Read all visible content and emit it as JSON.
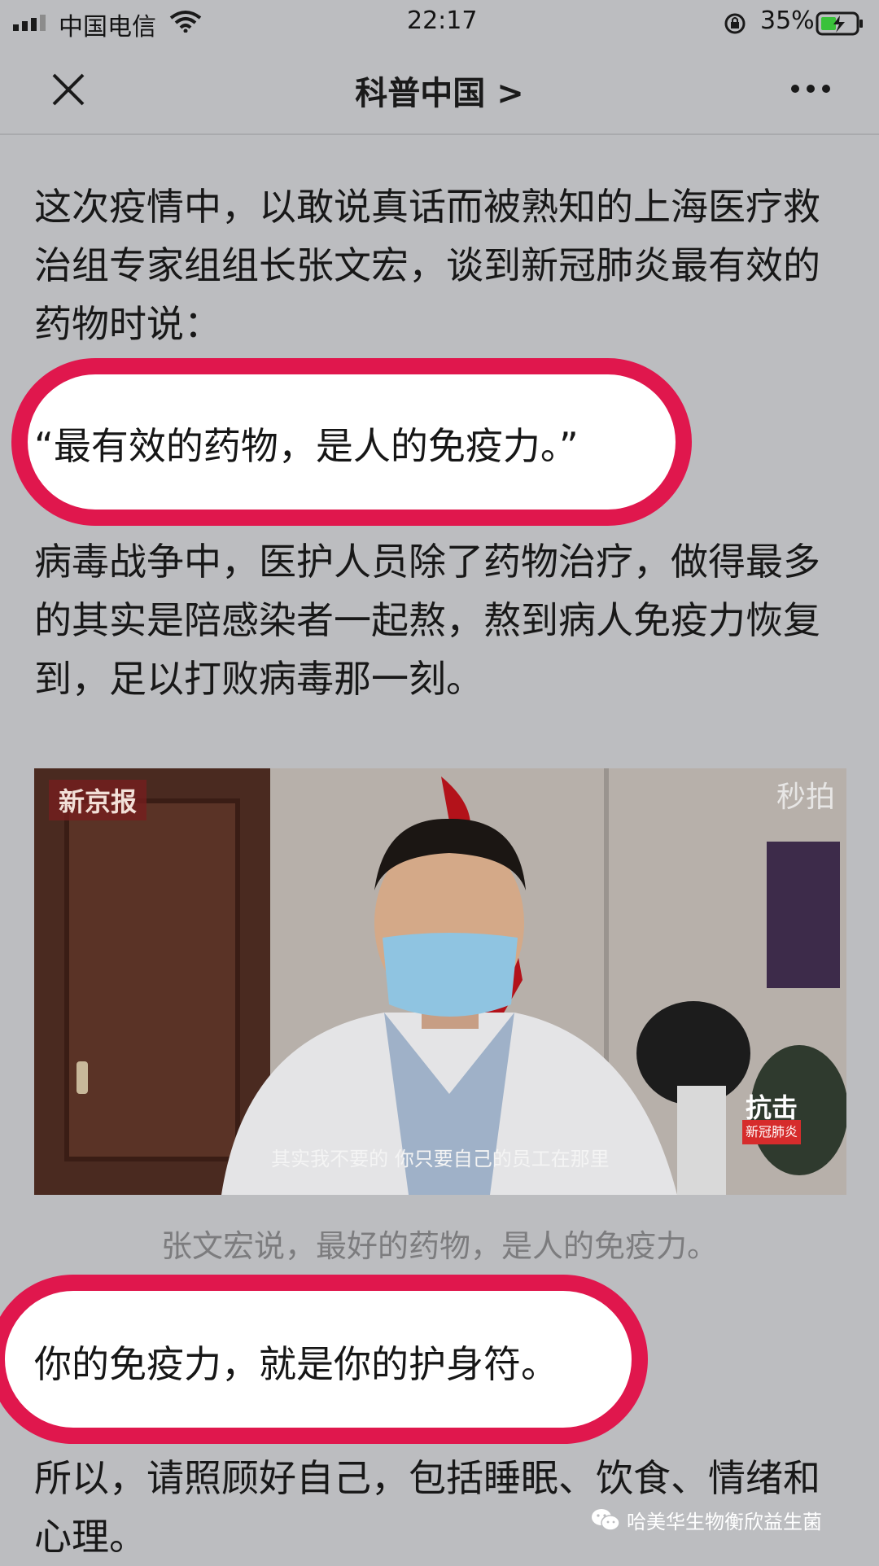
{
  "status_bar": {
    "carrier": "中国电信",
    "time": "22:17",
    "battery": "35%",
    "icons": [
      "signal-icon",
      "wifi-icon",
      "lock-rotation-icon",
      "battery-charging-icon"
    ]
  },
  "nav": {
    "title": "科普中国 >",
    "icons": [
      "close-icon",
      "more-icon"
    ]
  },
  "article": {
    "intro": "这次疫情中，以敢说真话而被熟知的上海医疗救治组专家组组长张文宏，谈到新冠肺炎最有效的药物时说：",
    "highlight_1": "“最有效的药物，是人的免疫力。”",
    "body": "病毒战争中，医护人员除了药物治疗，做得最多的其实是陪感染者一起熬，熬到病人免疫力恢复到，足以打败病毒那一刻。",
    "image": {
      "source_badge": "新京报",
      "app_watermark": "秒拍",
      "subtitle": "其实我不要的 你只要自己的员工在那里",
      "corner_logo": "抗击",
      "corner_logo_sub": "新冠肺炎"
    },
    "caption": "张文宏说，最好的药物，是人的免疫力。",
    "highlight_2": "你的免疫力，就是你的护身符。",
    "closing": "所以，请照顾好自己，包括睡眠、饮食、情绪和心理。"
  },
  "watermark": {
    "account": "哈美华生物衡欣益生菌",
    "icon": "wechat-icon"
  },
  "colors": {
    "background": "#bcbdc0",
    "highlight_border": "#e0174d",
    "highlight_fill": "#ffffff",
    "caption": "#7c7c7e"
  }
}
